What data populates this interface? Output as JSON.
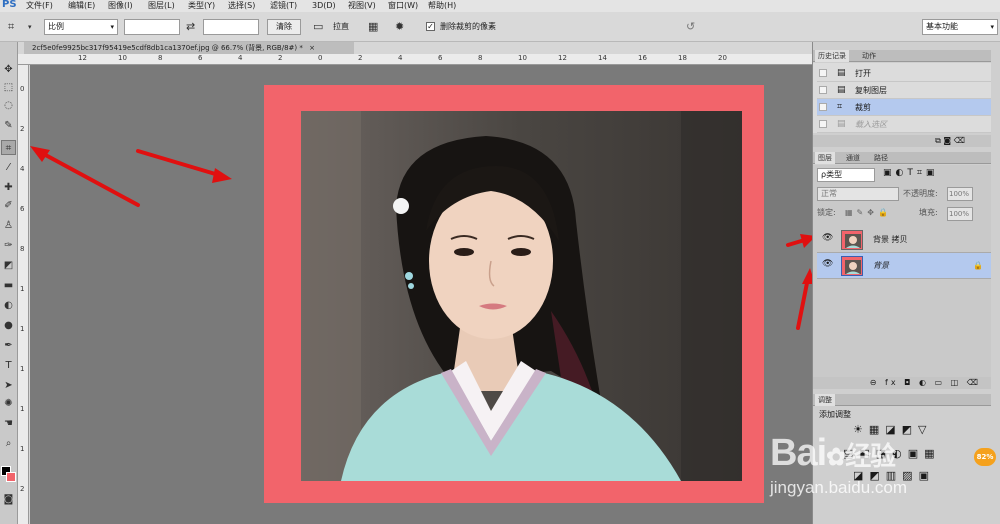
{
  "menubar": {
    "logo": "PS",
    "items": [
      "文件(F)",
      "编辑(E)",
      "图像(I)",
      "图层(L)",
      "类型(Y)",
      "选择(S)",
      "滤镜(T)",
      "3D(D)",
      "视图(V)",
      "窗口(W)",
      "帮助(H)"
    ]
  },
  "options": {
    "crop_icon": "crop-tool-icon",
    "ratio_select": "比例",
    "clear_label": "清除",
    "straighten_label": "拉直",
    "delete_cropped_label": "删除裁剪的像素",
    "delete_cropped_checked": true,
    "workspace_select": "基本功能"
  },
  "document": {
    "tab_title": "2cf5e0fe9925bc317f95419e5cdf8db1ca1370ef.jpg @ 66.7% (背景, RGB/8#) *",
    "close": "×"
  },
  "ruler_top": [
    "12",
    "10",
    "8",
    "6",
    "4",
    "2",
    "0",
    "2",
    "4",
    "6",
    "8",
    "10",
    "12",
    "14",
    "16",
    "18",
    "20"
  ],
  "ruler_left": [
    "0",
    "2",
    "4",
    "6",
    "8",
    "1",
    "1",
    "1",
    "1",
    "1",
    "2"
  ],
  "history": {
    "tabs": [
      "历史记录",
      "动作"
    ],
    "items": [
      {
        "label": "打开",
        "icon": "document-icon"
      },
      {
        "label": "复制图层",
        "icon": "document-icon"
      },
      {
        "label": "裁剪",
        "icon": "crop-icon"
      },
      {
        "label": "载入选区",
        "icon": "document-icon"
      }
    ],
    "selected": "裁剪"
  },
  "layers": {
    "tabs": [
      "图层",
      "通道",
      "路径"
    ],
    "filter_label": "ρ类型",
    "blend_mode": "正常",
    "opacity_label": "不透明度:",
    "opacity_value": "100%",
    "lock_label": "锁定:",
    "fill_label": "填充:",
    "fill_value": "100%",
    "items": [
      {
        "name": "背景 拷贝",
        "italic": false
      },
      {
        "name": "背景",
        "italic": true
      }
    ],
    "bottom_icons": "⊖ fx ◘ ◐ ▭ ◫ ⌫"
  },
  "adjustments": {
    "tab": "调整",
    "title": "添加调整"
  },
  "badge": "82%",
  "watermark": {
    "brand": "Bai",
    "brand2": "经验",
    "url": "jingyan.baidu.com"
  },
  "colors": {
    "frame": "#f2646b",
    "arrow": "#e01010",
    "selection": "#b4c9ee",
    "badge": "#f5a11c"
  }
}
